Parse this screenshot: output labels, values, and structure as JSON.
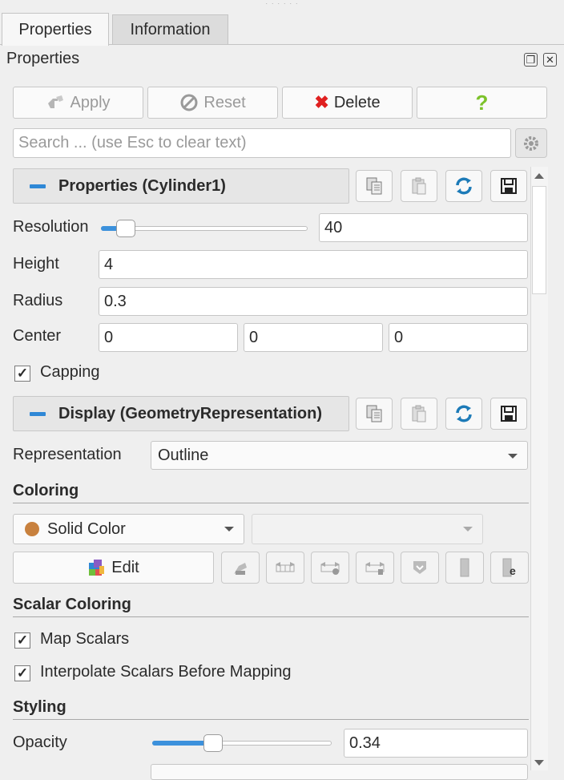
{
  "tabs": [
    {
      "label": "Properties",
      "active": true
    },
    {
      "label": "Information",
      "active": false
    }
  ],
  "panel": {
    "title": "Properties"
  },
  "toolbar": {
    "apply": "Apply",
    "reset": "Reset",
    "delete": "Delete",
    "help": "?"
  },
  "search": {
    "placeholder": "Search ... (use Esc to clear text)"
  },
  "sections": {
    "properties": {
      "title": "Properties (Cylinder1)"
    },
    "display": {
      "title": "Display (GeometryRepresentation)"
    }
  },
  "resolution": {
    "label": "Resolution",
    "value": "40",
    "slider_fraction": 0.12
  },
  "height": {
    "label": "Height",
    "value": "4"
  },
  "radius": {
    "label": "Radius",
    "value": "0.3"
  },
  "center": {
    "label": "Center",
    "x": "0",
    "y": "0",
    "z": "0"
  },
  "capping": {
    "label": "Capping",
    "checked": true
  },
  "representation": {
    "label": "Representation",
    "value": "Outline"
  },
  "coloring": {
    "title": "Coloring",
    "mode": "Solid Color",
    "swatch_color": "#c8813e",
    "secondary": "",
    "edit": "Edit"
  },
  "scalar_coloring": {
    "title": "Scalar Coloring",
    "map_scalars": {
      "label": "Map Scalars",
      "checked": true
    },
    "interpolate": {
      "label": "Interpolate Scalars Before Mapping",
      "checked": true
    }
  },
  "styling": {
    "title": "Styling"
  },
  "opacity": {
    "label": "Opacity",
    "value": "0.34",
    "slider_fraction": 0.34
  },
  "colors": {
    "accent": "#3c91dc",
    "delete_x": "#e02020",
    "help": "#7cc22a",
    "refresh": "#1d7bb8"
  },
  "icons": [
    "restore-icon",
    "close-icon",
    "apply-icon",
    "reset-icon",
    "delete-icon",
    "help-icon",
    "gear-icon",
    "copy-icon",
    "paste-icon",
    "refresh-icon",
    "save-icon",
    "edit-colormap-icon"
  ]
}
